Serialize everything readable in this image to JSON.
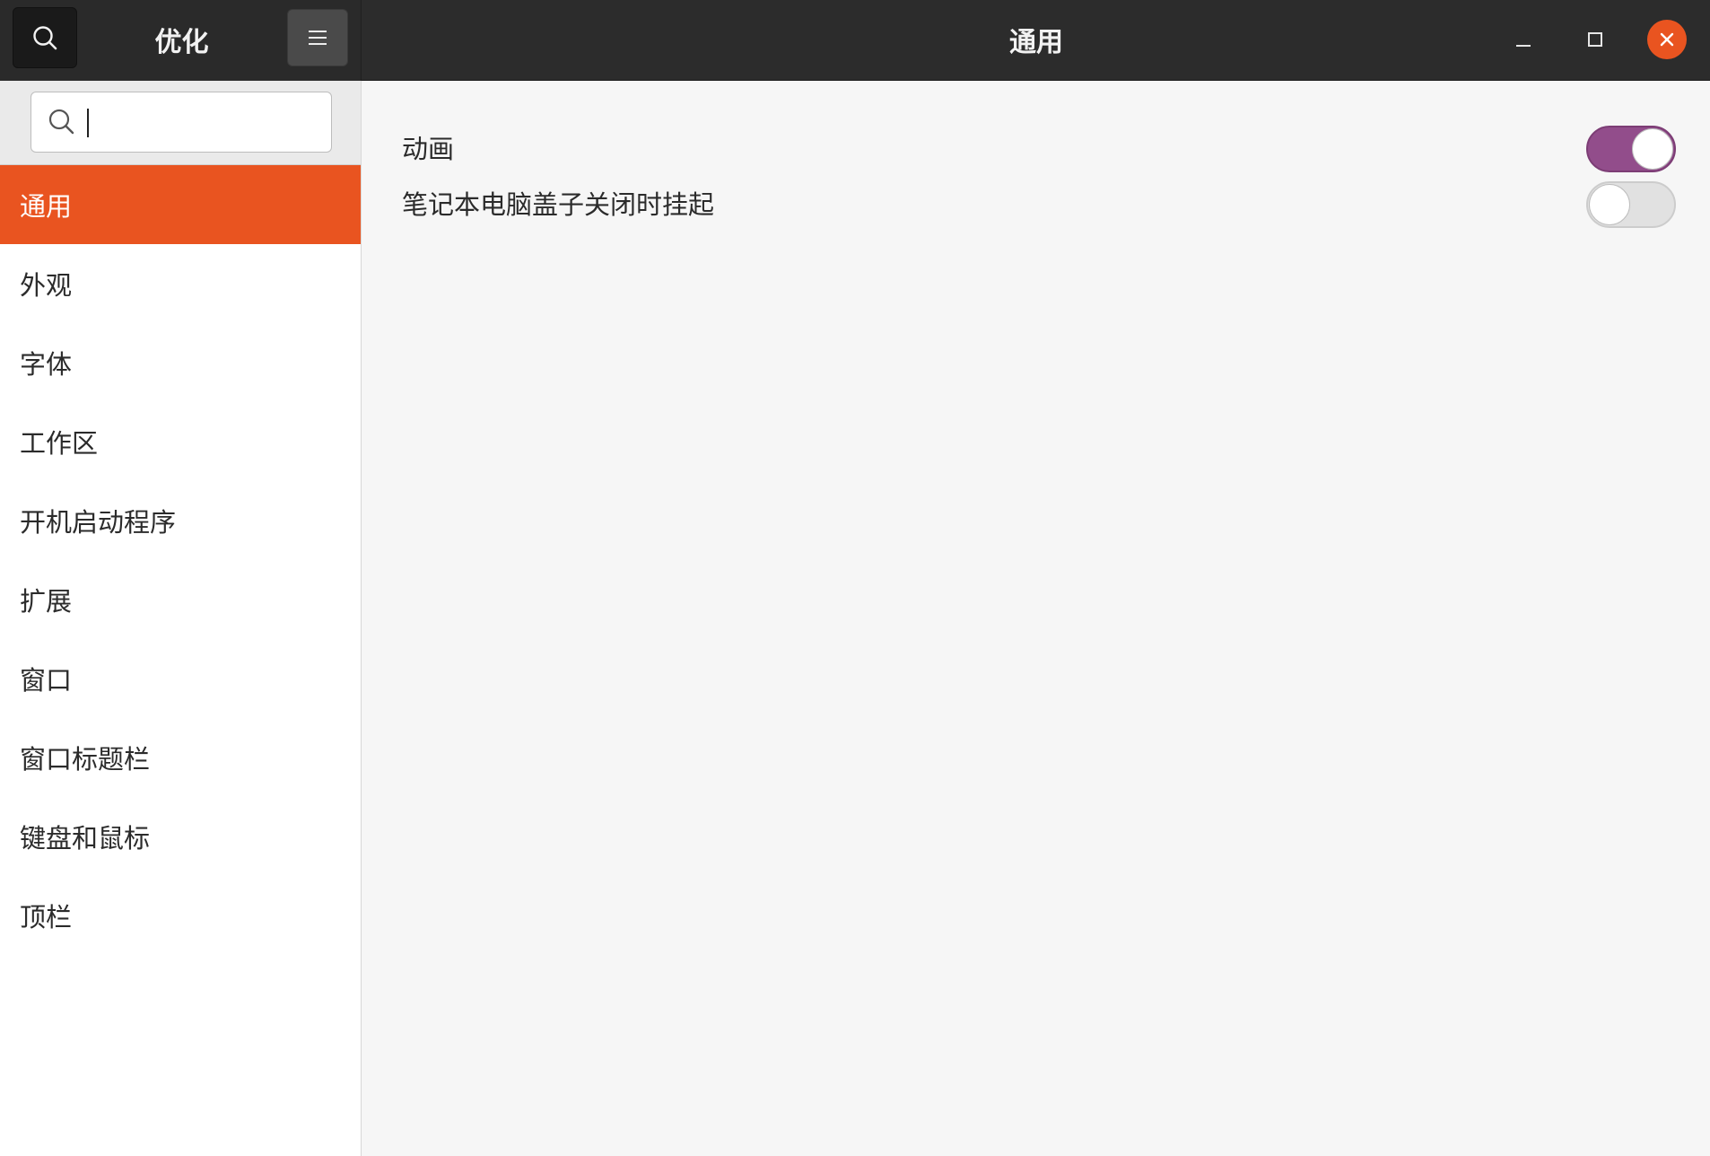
{
  "header": {
    "app_title": "优化",
    "page_title": "通用",
    "icons": {
      "search": "search-icon",
      "menu": "hamburger-menu-icon",
      "minimize": "minimize-icon",
      "maximize": "maximize-icon",
      "close": "close-icon"
    },
    "close_color": "#e95420"
  },
  "sidebar": {
    "search": {
      "value": "",
      "placeholder": ""
    },
    "items": [
      {
        "label": "通用",
        "active": true
      },
      {
        "label": "外观",
        "active": false
      },
      {
        "label": "字体",
        "active": false
      },
      {
        "label": "工作区",
        "active": false
      },
      {
        "label": "开机启动程序",
        "active": false
      },
      {
        "label": "扩展",
        "active": false
      },
      {
        "label": "窗口",
        "active": false
      },
      {
        "label": "窗口标题栏",
        "active": false
      },
      {
        "label": "键盘和鼠标",
        "active": false
      },
      {
        "label": "顶栏",
        "active": false
      }
    ],
    "active_color": "#e95420"
  },
  "main": {
    "settings": [
      {
        "label": "动画",
        "enabled": true
      },
      {
        "label": "笔记本电脑盖子关闭时挂起",
        "enabled": false
      }
    ],
    "switch_on_color": "#924d8b"
  }
}
